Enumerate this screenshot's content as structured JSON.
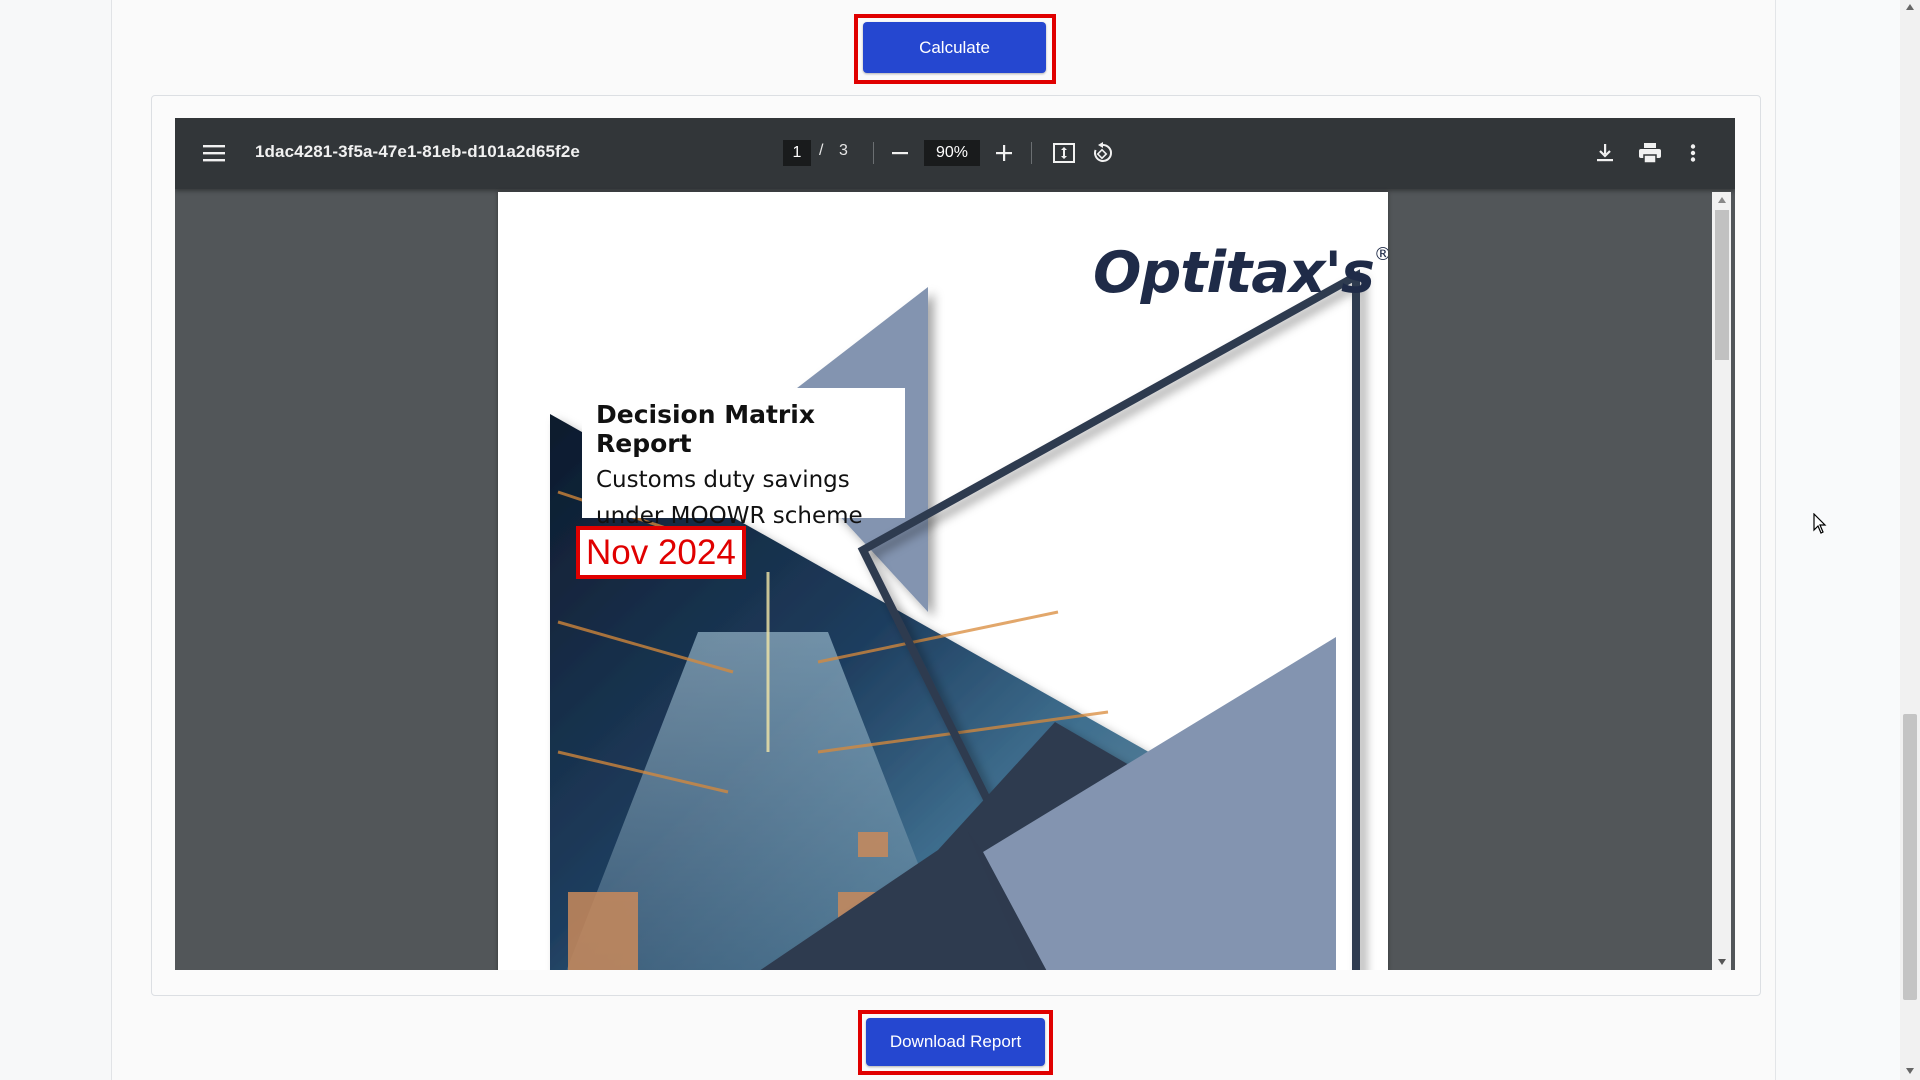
{
  "buttons": {
    "calculate_label": "Calculate",
    "download_label": "Download Report"
  },
  "pdf_viewer": {
    "filename": "1dac4281-3f5a-47e1-81eb-d101a2d65f2e",
    "current_page": "1",
    "page_separator": "/",
    "total_pages": "3",
    "zoom": "90%",
    "icons": [
      "menu-icon",
      "zoom-out-icon",
      "zoom-in-icon",
      "fit-page-icon",
      "rotate-icon",
      "download-icon",
      "print-icon",
      "more-options-icon"
    ]
  },
  "document": {
    "logo": "Optitax's",
    "logo_mark": "®",
    "report_title": "Decision Matrix Report",
    "subtitle_line1": "Customs duty savings",
    "subtitle_line2": "under MOOWR scheme",
    "date": "Nov 2024"
  },
  "colors": {
    "button_blue": "#2547d0",
    "highlight_red": "#e00000",
    "toolbar": "#323639",
    "viewer_bg": "#525659",
    "navy": "#2f3a4f",
    "slate_blue": "#8394b0"
  }
}
